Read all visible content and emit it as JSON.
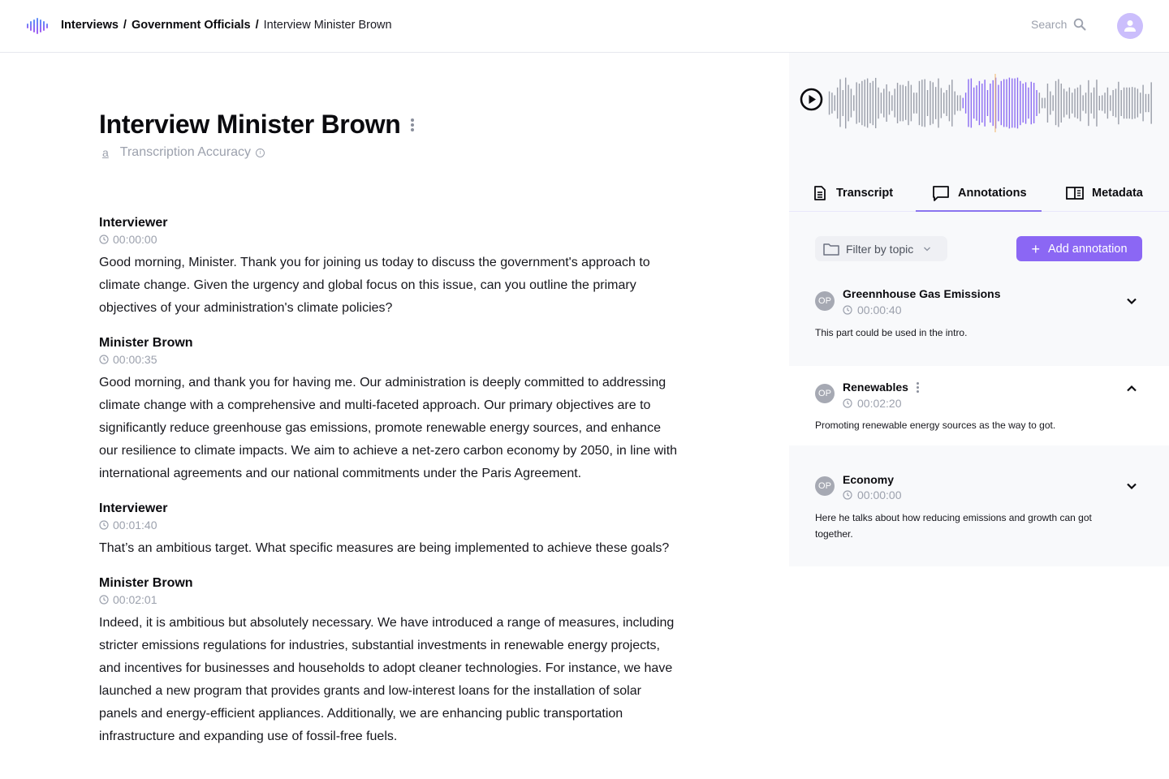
{
  "header": {
    "logo": "waveform-logo-icon",
    "breadcrumb": [
      {
        "label": "Interviews"
      },
      {
        "label": "Government Officials"
      },
      {
        "label": "Interview Minister Brown"
      }
    ],
    "separator": "/",
    "search_label": "Search",
    "avatar_icon": "user-icon"
  },
  "page": {
    "title": "Interview Minister Brown",
    "accuracy_label": "Transcription Accuracy",
    "accuracy_icon_glyph": "a",
    "info_glyph": "i"
  },
  "transcript": [
    {
      "speaker": "Interviewer",
      "time": "00:00:00",
      "text": "Good morning, Minister. Thank you for joining us today to discuss the government's approach to climate change. Given the urgency and global focus on this issue, can you outline the primary objectives of your administration's climate policies?"
    },
    {
      "speaker": "Minister Brown",
      "time": "00:00:35",
      "text": "Good morning, and thank you for having me. Our administration is deeply committed to addressing climate change with a comprehensive and multi-faceted approach. Our primary objectives are to significantly reduce greenhouse gas emissions, promote renewable energy sources, and enhance our resilience to climate impacts. We aim to achieve a net-zero carbon economy by 2050, in line with international agreements and our national commitments under the Paris Agreement."
    },
    {
      "speaker": "Interviewer",
      "time": "00:01:40",
      "text": "That’s an ambitious target. What specific measures are being implemented to achieve these goals?"
    },
    {
      "speaker": "Minister Brown",
      "time": "00:02:01",
      "text": "Indeed, it is ambitious but absolutely necessary. We have introduced a range of measures, including stricter emissions regulations for industries, substantial investments in renewable energy projects, and incentives for businesses and households to adopt cleaner technologies. For instance, we have launched a new program that provides grants and low-interest loans for the installation of solar panels and energy-efficient appliances. Additionally, we are enhancing public transportation infrastructure and expanding use of fossil-free fuels."
    }
  ],
  "player": {
    "play_icon": "play-icon",
    "waveform": {
      "amplitudes": [
        0.45,
        0.4,
        0.3,
        0.6,
        0.92,
        0.5,
        0.98,
        0.7,
        0.55,
        0.3,
        0.8,
        0.75,
        0.85,
        0.9,
        0.95,
        0.78,
        0.85,
        0.97,
        0.6,
        0.4,
        0.55,
        0.72,
        0.45,
        0.3,
        0.55,
        0.78,
        0.7,
        0.7,
        0.65,
        0.85,
        0.7,
        0.4,
        0.4,
        0.85,
        0.9,
        0.92,
        0.5,
        0.85,
        0.8,
        0.62,
        0.95,
        0.58,
        0.4,
        0.5,
        0.7,
        0.9,
        0.45,
        0.3,
        0.3,
        0.2,
        0.4,
        0.92,
        0.95,
        0.6,
        0.68,
        0.85,
        0.75,
        0.9,
        0.5,
        0.75,
        0.88,
        0.98,
        0.7,
        0.85,
        0.92,
        0.92,
        0.98,
        0.95,
        0.95,
        0.98,
        0.85,
        0.75,
        0.8,
        0.6,
        0.82,
        0.78,
        0.5,
        0.4,
        0.2,
        0.2,
        0.75,
        0.45,
        0.3,
        0.85,
        0.92,
        0.75,
        0.55,
        0.45,
        0.6,
        0.4,
        0.55,
        0.6,
        0.7,
        0.3,
        0.4,
        0.88,
        0.4,
        0.6,
        0.9,
        0.28,
        0.3,
        0.4,
        0.6,
        0.3,
        0.5,
        0.55,
        0.82,
        0.5,
        0.6,
        0.6,
        0.6,
        0.62,
        0.6,
        0.55,
        0.4,
        0.7,
        0.35,
        0.35,
        0.8
      ],
      "played_range_fraction": [
        0.405,
        0.645
      ],
      "playhead_fraction": 0.515,
      "colors": {
        "unplayed": "#9a9ea9",
        "played": "#8b6cf2",
        "playhead": "#f2b366"
      }
    }
  },
  "tabs": [
    {
      "label": "Transcript",
      "icon": "document-icon",
      "active": false
    },
    {
      "label": "Annotations",
      "icon": "comment-icon",
      "active": true
    },
    {
      "label": "Metadata",
      "icon": "book-icon",
      "active": false
    }
  ],
  "annotations_toolbar": {
    "filter_label": "Filter by topic",
    "filter_icon": "folder-icon",
    "add_label": "Add annotation",
    "add_icon": "plus-icon"
  },
  "annotations": [
    {
      "initials": "OP",
      "title": "Greennhouse Gas Emissions",
      "time": "00:00:40",
      "body": "This part could be used in the intro.",
      "expanded": false,
      "has_menu": false
    },
    {
      "initials": "OP",
      "title": "Renewables",
      "time": "00:02:20",
      "body": "Promoting renewable energy sources as the way to got.",
      "expanded": true,
      "has_menu": true
    },
    {
      "initials": "OP",
      "title": "Economy",
      "time": "00:00:00",
      "body": "Here he talks about how reducing emissions and growth can got together.",
      "expanded": false,
      "has_menu": false
    }
  ],
  "colors": {
    "accent": "#8b67f4",
    "avatar_bg": "#cbbefc",
    "muted_text": "#9ca1ad",
    "panel_bg": "#f8f9fb"
  }
}
